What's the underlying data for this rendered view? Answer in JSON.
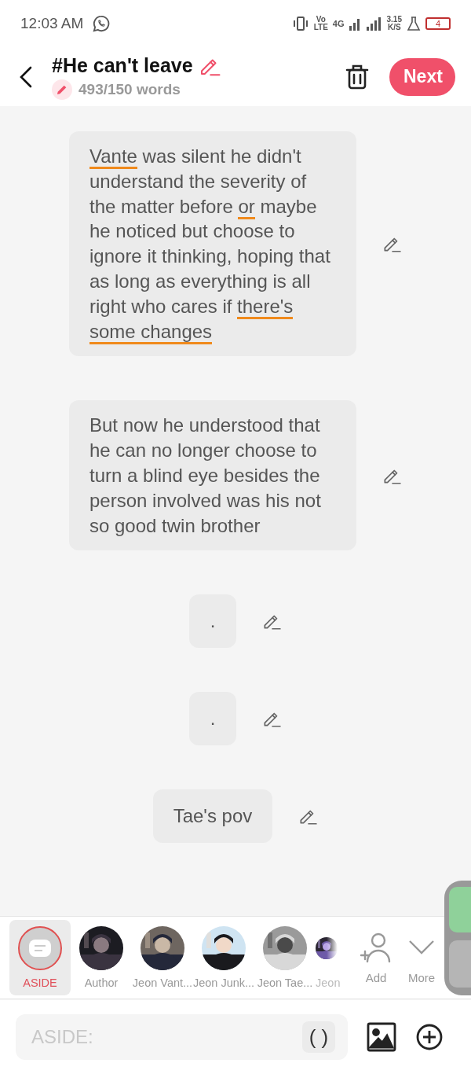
{
  "status_bar": {
    "time": "12:03 AM",
    "volte_top": "Vo",
    "volte_bottom": "LTE",
    "network": "4G",
    "speed": "3.15",
    "speed_unit": "K/S",
    "battery": "4"
  },
  "header": {
    "title": "#He can't leave",
    "word_count": "493/150 words",
    "next_button": "Next"
  },
  "messages": [
    {
      "segments": [
        {
          "text": "Vante",
          "flagged": true
        },
        {
          "text": " was silent he didn't understand the severity of the matter before ",
          "flagged": false
        },
        {
          "text": "or",
          "flagged": true
        },
        {
          "text": " maybe he noticed but choose to ignore it thinking, hoping that as long as everything is all right who cares if ",
          "flagged": false
        },
        {
          "text": "there's some changes",
          "flagged": true
        }
      ]
    },
    {
      "segments": [
        {
          "text": "But now he understood that he can no longer choose to turn a blind eye besides the person involved was his not so good twin brother",
          "flagged": false
        }
      ]
    },
    {
      "segments": [
        {
          "text": ".",
          "flagged": false
        }
      ]
    },
    {
      "segments": [
        {
          "text": ".",
          "flagged": false
        }
      ]
    },
    {
      "segments": [
        {
          "text": "Tae's pov",
          "flagged": false
        }
      ]
    }
  ],
  "characters": [
    {
      "kind": "aside",
      "name": "ASIDE",
      "selected": true
    },
    {
      "kind": "avatar",
      "name": "Author",
      "selected": false
    },
    {
      "kind": "avatar",
      "name": "Jeon Vant...",
      "selected": false
    },
    {
      "kind": "avatar",
      "name": "Jeon Junk...",
      "selected": false
    },
    {
      "kind": "avatar",
      "name": "Jeon Tae...",
      "selected": false
    },
    {
      "kind": "avatar",
      "name": "Jeon",
      "selected": false
    }
  ],
  "add_label": "Add",
  "more_label": "More",
  "input": {
    "placeholder": "ASIDE:",
    "bracket_button": "( )"
  }
}
